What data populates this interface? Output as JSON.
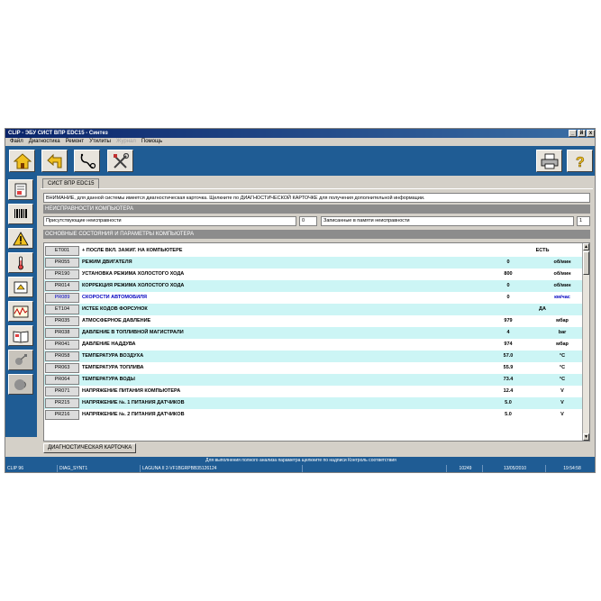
{
  "window": {
    "title": "CLIP - ЭБУ СИСТ ВПР EDC15 - Синтез",
    "buttons": [
      "_",
      "й",
      "x"
    ]
  },
  "menu": [
    {
      "label": "Файл",
      "enabled": true
    },
    {
      "label": "Диагностика",
      "enabled": true
    },
    {
      "label": "Ремонт",
      "enabled": true
    },
    {
      "label": "Утилиты",
      "enabled": true
    },
    {
      "label": "Журнал",
      "enabled": false
    },
    {
      "label": "Помощь",
      "enabled": true
    }
  ],
  "toolbar": {
    "left": [
      "home-icon",
      "back-arrow-icon",
      "stethoscope-icon",
      "tools-icon"
    ],
    "right": [
      "printer-icon",
      "help-icon"
    ]
  },
  "sidebar": [
    "ecu-notebook-icon",
    "barcode-icon",
    "warning-icon",
    "thermometer-icon",
    "tester-icon",
    "oscilloscope-icon",
    "manual-book-icon",
    "satellite-icon",
    "speaker-icon"
  ],
  "tab": {
    "label": "СИСТ ВПР EDC15"
  },
  "notice": "ВНИМАНИЕ, для данной системы имеется диагностическая карточка. Щелкните по ДИАГНОСТИЧЕСКОЙ КАРТОЧКЕ для получения дополнительной информации.",
  "faults": {
    "header": "НЕИСПРАВНОСТИ КОМПЬЮТЕРА",
    "present_label": "Присутствующие неисправности",
    "present_count": "0",
    "stored_label": "Записанные в памяти неисправности",
    "stored_count": "1"
  },
  "params": {
    "header": "ОСНОВНЫЕ СОСТОЯНИЯ И ПАРАМЕТРЫ КОМПЬЮТЕРА",
    "rows": [
      {
        "code": "ET001",
        "label": "+ ПОСЛЕ ВКЛ. ЗАЖИГ. НА КОМПЬЮТЕРЕ",
        "value": "ЕСТЬ",
        "unit": "",
        "highlight": false,
        "blue": false,
        "single": true
      },
      {
        "code": "PR055",
        "label": "РЕЖИМ ДВИГАТЕЛЯ",
        "value": "0",
        "unit": "об/мин",
        "highlight": true,
        "blue": false,
        "single": false
      },
      {
        "code": "PR190",
        "label": "УСТАНОВКА РЕЖИМА ХОЛОСТОГО ХОДА",
        "value": "800",
        "unit": "об/мин",
        "highlight": false,
        "blue": false,
        "single": false
      },
      {
        "code": "PR014",
        "label": "КОРРЕКЦИЯ РЕЖИМА ХОЛОСТОГО ХОДА",
        "value": "0",
        "unit": "об/мин",
        "highlight": true,
        "blue": false,
        "single": false
      },
      {
        "code": "PR089",
        "label": "СКОРОСТИ АВТОМОБИЛЯ",
        "value": "0",
        "unit": "км/час",
        "highlight": false,
        "blue": true,
        "single": false
      },
      {
        "code": "ET104",
        "label": "ИСТЕЕ КОДОВ ФОРСУНОК",
        "value": "ДА",
        "unit": "",
        "highlight": true,
        "blue": false,
        "single": true
      },
      {
        "code": "PR035",
        "label": "АТМОСФЕРНОЕ ДАВЛЕНИЕ",
        "value": "979",
        "unit": "мбар",
        "highlight": false,
        "blue": false,
        "single": false
      },
      {
        "code": "PR038",
        "label": "ДАВЛЕНИЕ В ТОПЛИВНОЙ МАГИСТРАЛИ",
        "value": "4",
        "unit": "bar",
        "highlight": true,
        "blue": false,
        "single": false
      },
      {
        "code": "PR041",
        "label": "ДАВЛЕНИЕ НАДДУВА",
        "value": "974",
        "unit": "мбар",
        "highlight": false,
        "blue": false,
        "single": false
      },
      {
        "code": "PR058",
        "label": "ТЕМПЕРАТУРА ВОЗДУХА",
        "value": "57.0",
        "unit": "°C",
        "highlight": true,
        "blue": false,
        "single": false
      },
      {
        "code": "PR063",
        "label": "ТЕМПЕРАТУРА ТОПЛИВА",
        "value": "55.9",
        "unit": "°C",
        "highlight": false,
        "blue": false,
        "single": false
      },
      {
        "code": "PR064",
        "label": "ТЕМПЕРАТУРА ВОДЫ",
        "value": "73.4",
        "unit": "°C",
        "highlight": true,
        "blue": false,
        "single": false
      },
      {
        "code": "PR071",
        "label": "НАПРЯЖЕНИЕ ПИТАНИЯ КОМПЬЮТЕРА",
        "value": "12.4",
        "unit": "V",
        "highlight": false,
        "blue": false,
        "single": false
      },
      {
        "code": "PR215",
        "label": "НАПРЯЖЕНИЕ №. 1 ПИТАНИЯ ДАТЧИКОВ",
        "value": "5.0",
        "unit": "V",
        "highlight": true,
        "blue": false,
        "single": false
      },
      {
        "code": "PR216",
        "label": "НАПРЯЖЕНИЕ №. 2 ПИТАНИЯ ДАТЧИКОВ",
        "value": "5.0",
        "unit": "V",
        "highlight": false,
        "blue": false,
        "single": false
      }
    ]
  },
  "scrollbar": {
    "up": "▲",
    "down": "▼"
  },
  "diag_button": "ДИАГНОСТИЧЕСКАЯ КАРТОЧКА",
  "hint": "Для выполнения полного анализа параметра щелкните по надписи Контроль соответствия",
  "status": {
    "clip": "CLIP 96",
    "diag": "DIAG_SYNT1",
    "vehicle": "LAGUNA II 2-VF1BGRPBB35126124",
    "number": "10249",
    "date": "13/05/2010",
    "time": "19:54:58"
  },
  "colors": {
    "frame_blue": "#1f5c94",
    "row_highlight": "#ccf5f5",
    "section_header": "#8c8c8c",
    "link_blue": "#0000c0"
  }
}
